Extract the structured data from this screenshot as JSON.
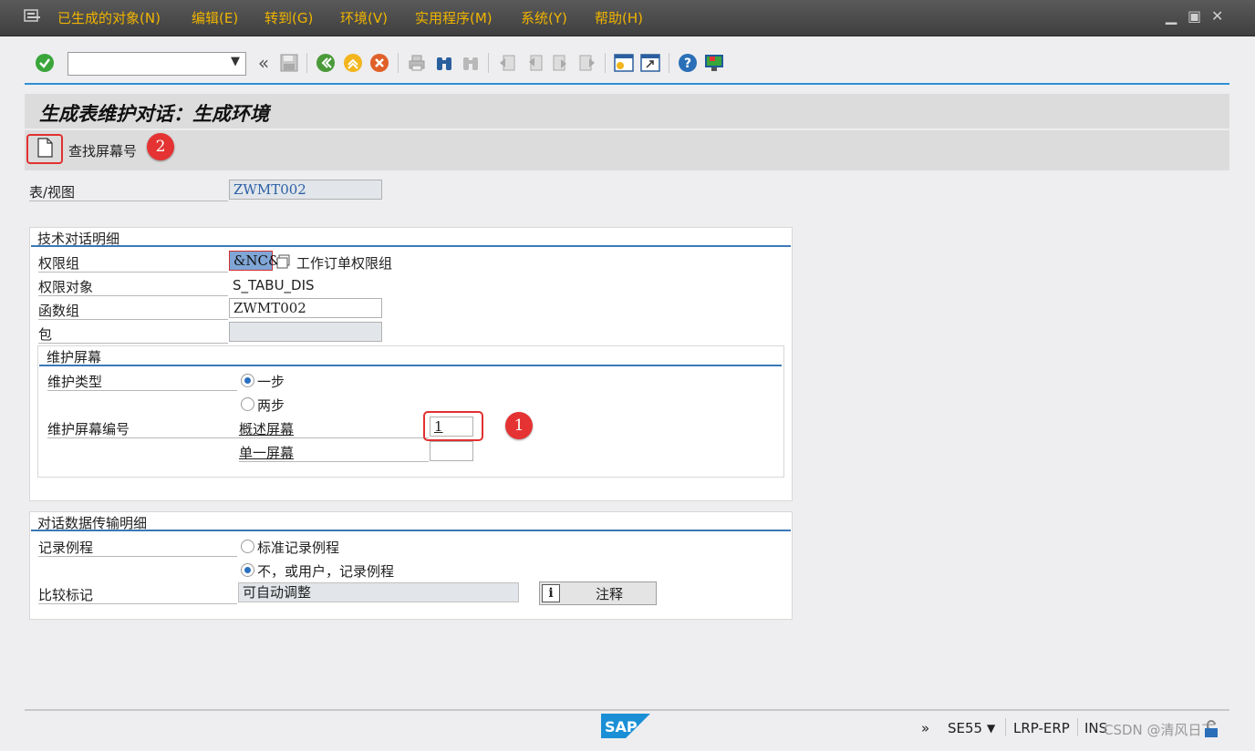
{
  "menu": {
    "items": [
      "已生成的对象(N)",
      "编辑(E)",
      "转到(G)",
      "环境(V)",
      "实用程序(M)",
      "系统(Y)",
      "帮助(H)"
    ]
  },
  "window_controls": {
    "minimize": "▁",
    "restore": "▣",
    "close": "✕"
  },
  "toolbar": {
    "command_field_value": "",
    "back_arrows": "«"
  },
  "title": "生成表维护对话：生成环境",
  "app_toolbar": {
    "find_screen_label": "查找屏幕号"
  },
  "markers": {
    "one": "1",
    "two": "2"
  },
  "table_view": {
    "label": "表/视图",
    "value": "ZWMT002"
  },
  "tech_group": {
    "title": "技术对话明细",
    "auth_group_label": "权限组",
    "auth_group_value": "&NC&",
    "auth_group_desc": "工作订单权限组",
    "auth_object_label": "权限对象",
    "auth_object_value": "S_TABU_DIS",
    "function_group_label": "函数组",
    "function_group_value": "ZWMT002",
    "package_label": "包",
    "package_value": ""
  },
  "maint_screen": {
    "title": "维护屏幕",
    "type_label": "维护类型",
    "one_step": "一步",
    "two_step": "两步",
    "selected_type": "one_step",
    "screen_no_label": "维护屏幕编号",
    "overview_label": "概述屏幕",
    "overview_value": "1",
    "single_label": "单一屏幕",
    "single_value": ""
  },
  "transport_group": {
    "title": "对话数据传输明细",
    "routine_label": "记录例程",
    "standard_option": "标准记录例程",
    "no_option": "不，或用户，记录例程",
    "selected_option": "no_option",
    "compare_label": "比较标记",
    "compare_value": "可自动调整",
    "comment_button": "注释"
  },
  "status_bar": {
    "expand": "»",
    "transaction": "SE55",
    "system": "LRP-ERP",
    "mode": "INS",
    "watermark": "CSDN @清风日下"
  },
  "colors": {
    "accent": "#2f8fd6",
    "menu_text": "#f0b400",
    "marker": "#e53333"
  }
}
